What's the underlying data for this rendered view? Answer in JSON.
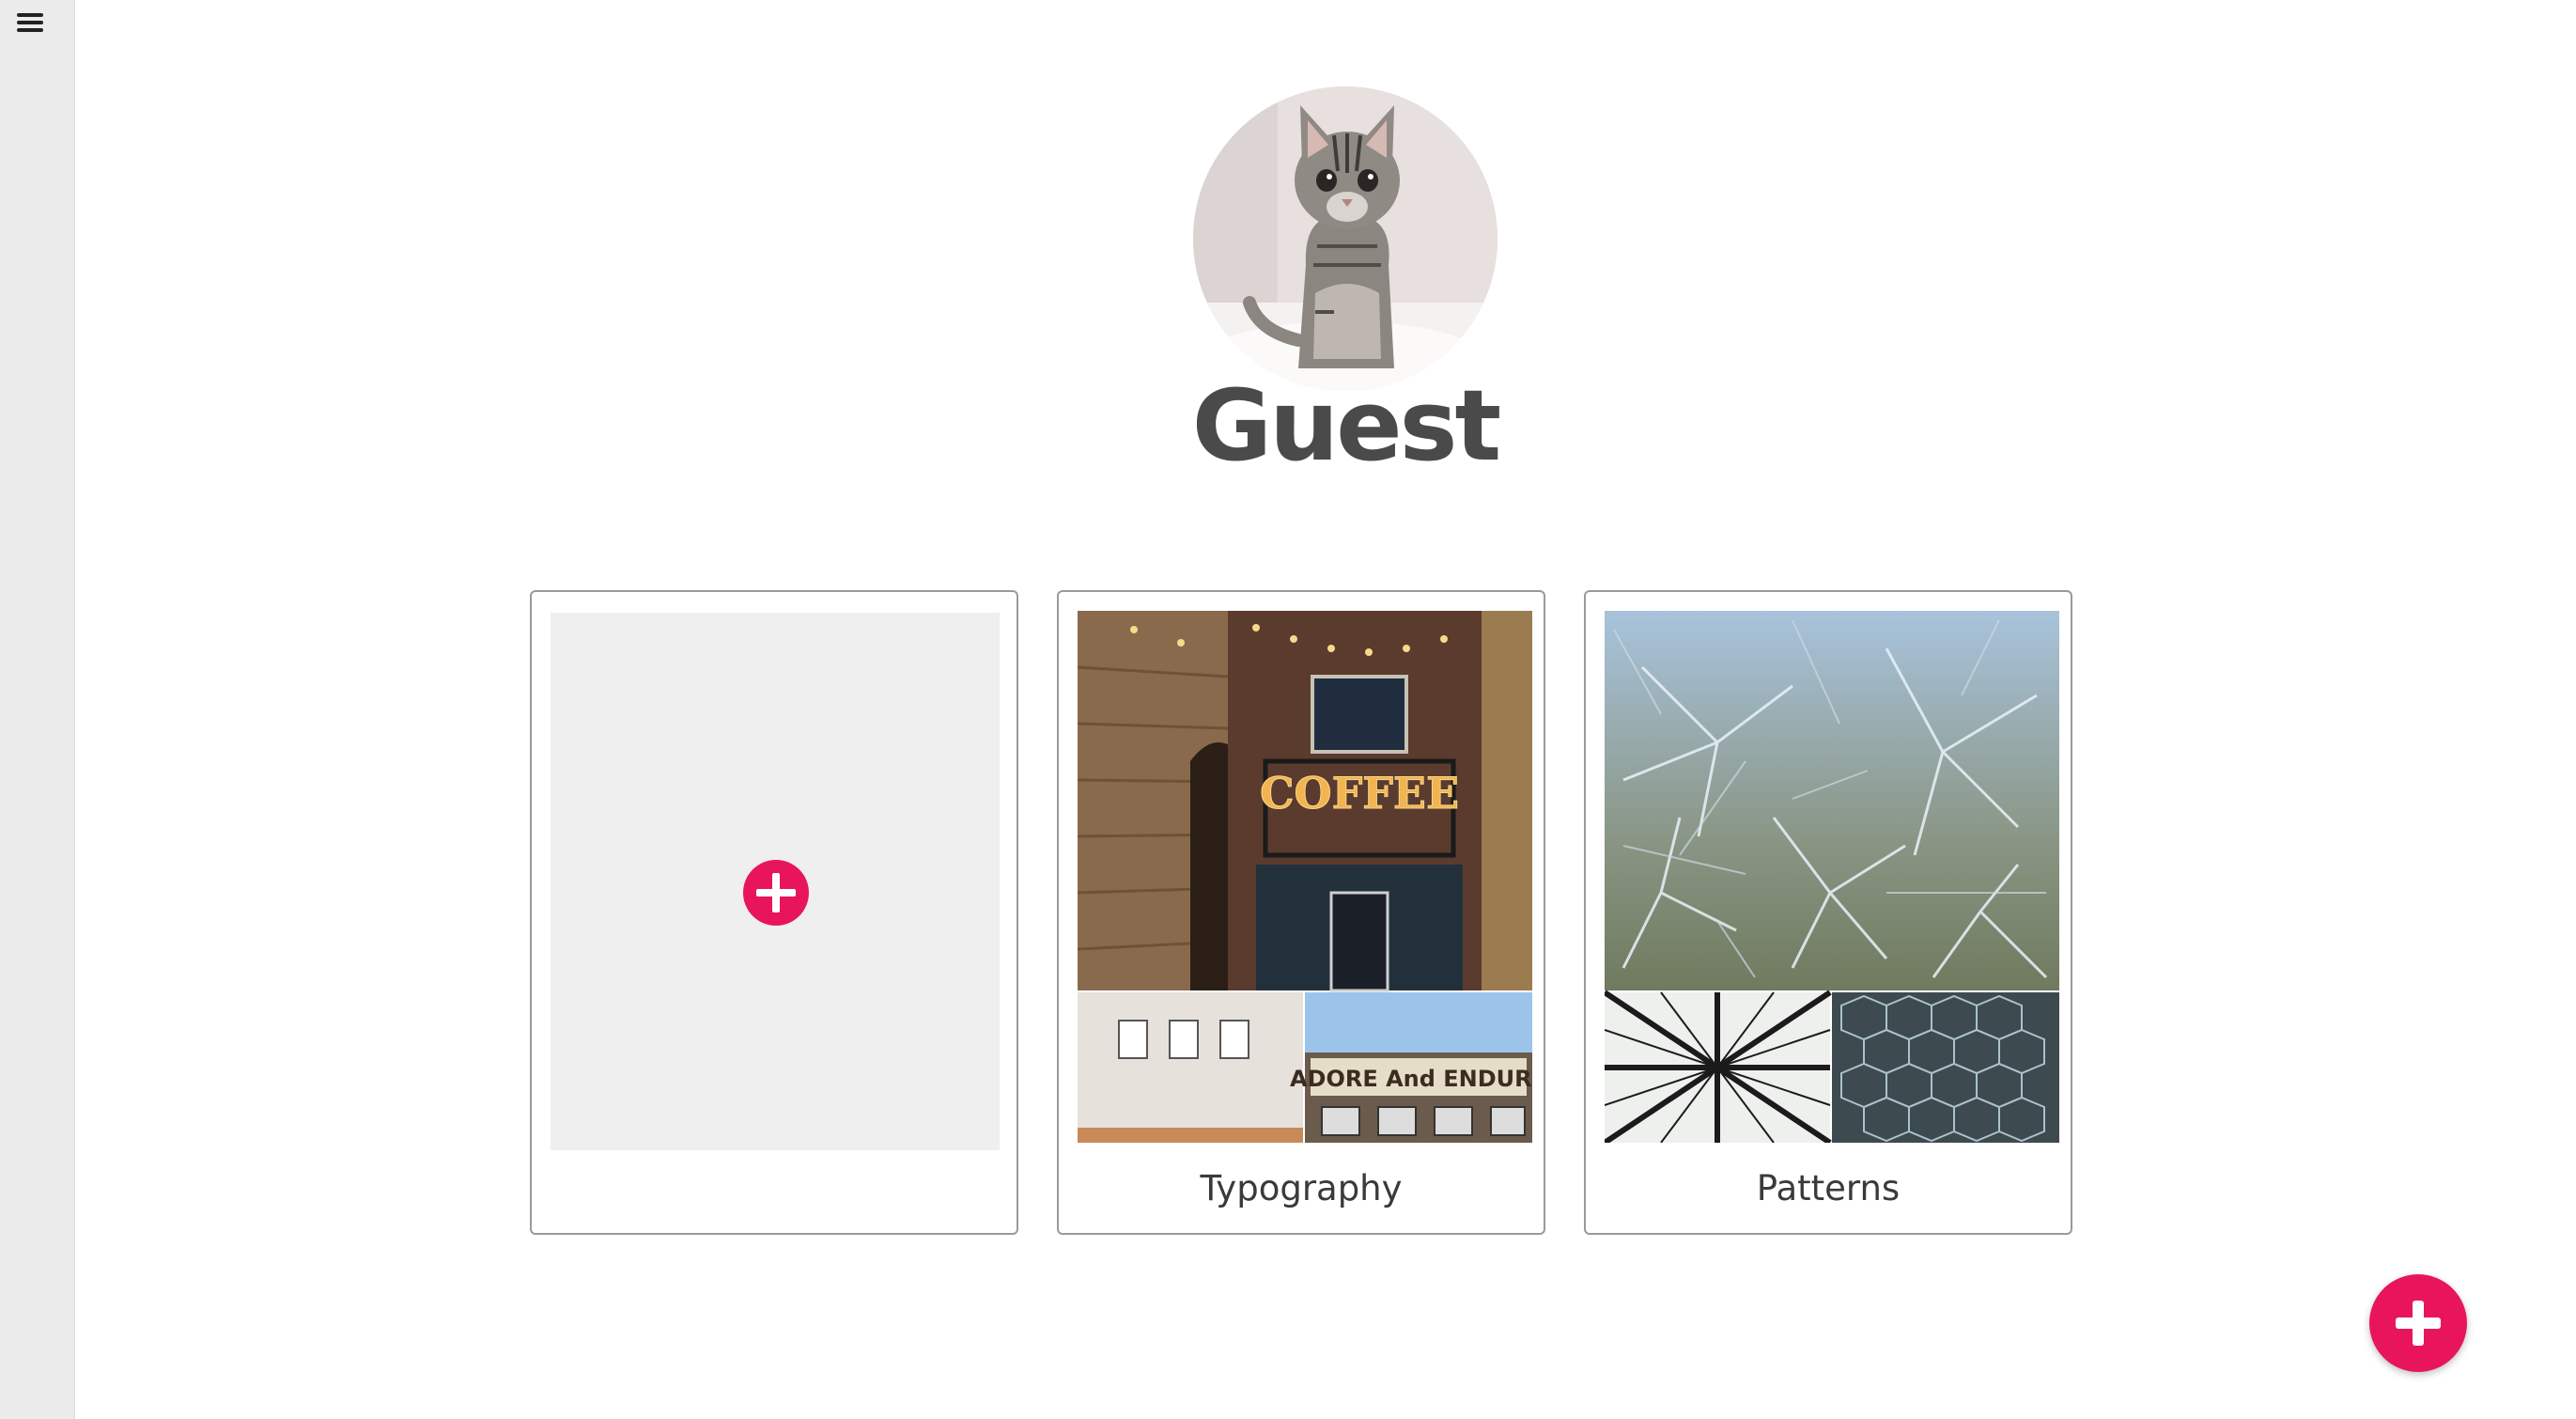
{
  "profile": {
    "name": "Guest"
  },
  "boards": [
    {
      "label": ""
    },
    {
      "label": "Typography"
    },
    {
      "label": "Patterns"
    }
  ],
  "typography_signs": {
    "main": "COFFEE",
    "banner": "ADORE And ENDURE"
  },
  "colors": {
    "accent": "#e8155d",
    "sidebar": "#ebebeb"
  },
  "icons": {
    "menu": "hamburger-icon",
    "add_board": "plus-circle-icon",
    "fab": "plus-icon"
  }
}
